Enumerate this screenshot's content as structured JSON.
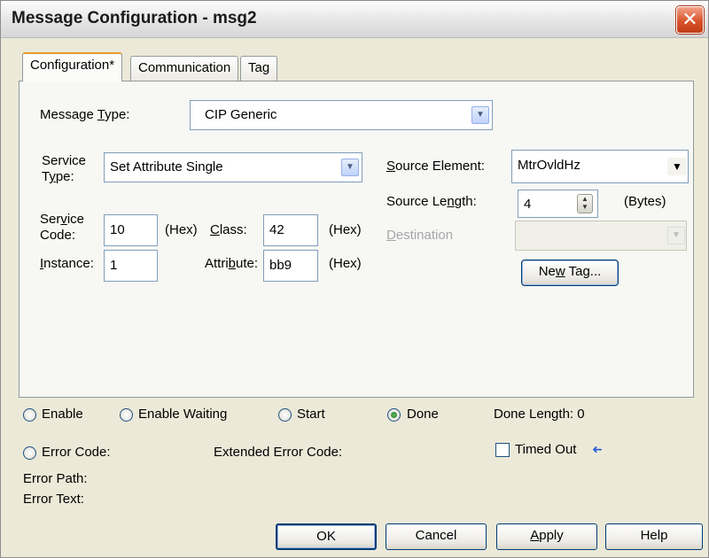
{
  "window": {
    "title": "Message Configuration - msg2",
    "close_symbol": "✕"
  },
  "tabs": [
    {
      "label": "Configuration*",
      "active": true
    },
    {
      "label": "Communication",
      "active": false
    },
    {
      "label": "Tag",
      "active": false
    }
  ],
  "config": {
    "message_type_label_pre": "Message ",
    "message_type_label_key": "T",
    "message_type_label_post": "ype:",
    "message_type_value": "CIP Generic",
    "service_type_label_1": "Service",
    "service_type_label_2_pre": "T",
    "service_type_label_2_key": "y",
    "service_type_label_2_post": "pe:",
    "service_type_value": "Set Attribute Single",
    "service_code_label_1_pre": "Ser",
    "service_code_label_1_key": "v",
    "service_code_label_1_post": "ice",
    "service_code_label_2": "Code:",
    "service_code_value": "10",
    "hex_label": "(Hex)",
    "class_label_key": "C",
    "class_label_post": "lass:",
    "class_value": "42",
    "instance_label_key": "I",
    "instance_label_post": "nstance:",
    "instance_value": "1",
    "attribute_label_pre": "Attri",
    "attribute_label_key": "b",
    "attribute_label_post": "ute:",
    "attribute_value": "bb9",
    "source_element_label_key": "S",
    "source_element_label_post": "ource Element:",
    "source_element_value": "MtrOvldHz",
    "source_length_label_pre": "Source Le",
    "source_length_label_key": "n",
    "source_length_label_post": "gth:",
    "source_length_value": "4",
    "bytes_label": "(Bytes)",
    "destination_label_key": "D",
    "destination_label_post": "estination",
    "destination_value": "",
    "new_tag_pre": "Ne",
    "new_tag_key": "w",
    "new_tag_post": " Tag..."
  },
  "status": {
    "enable": "Enable",
    "enable_waiting": "Enable Waiting",
    "start": "Start",
    "done": "Done",
    "done_length": "Done Length: 0",
    "error_code": "Error Code:",
    "extended_error_code": "Extended Error Code:",
    "timed_out": "Timed Out",
    "error_path": "Error Path:",
    "error_text": "Error Text:",
    "selected_radio": "done",
    "timed_out_checked": false
  },
  "buttons": {
    "ok": "OK",
    "cancel": "Cancel",
    "apply_key": "A",
    "apply_post": "pply",
    "help": "Help"
  },
  "icons": {
    "dropdown": "▼",
    "spin_up": "▲",
    "spin_down": "▼",
    "arrow": "➜"
  }
}
